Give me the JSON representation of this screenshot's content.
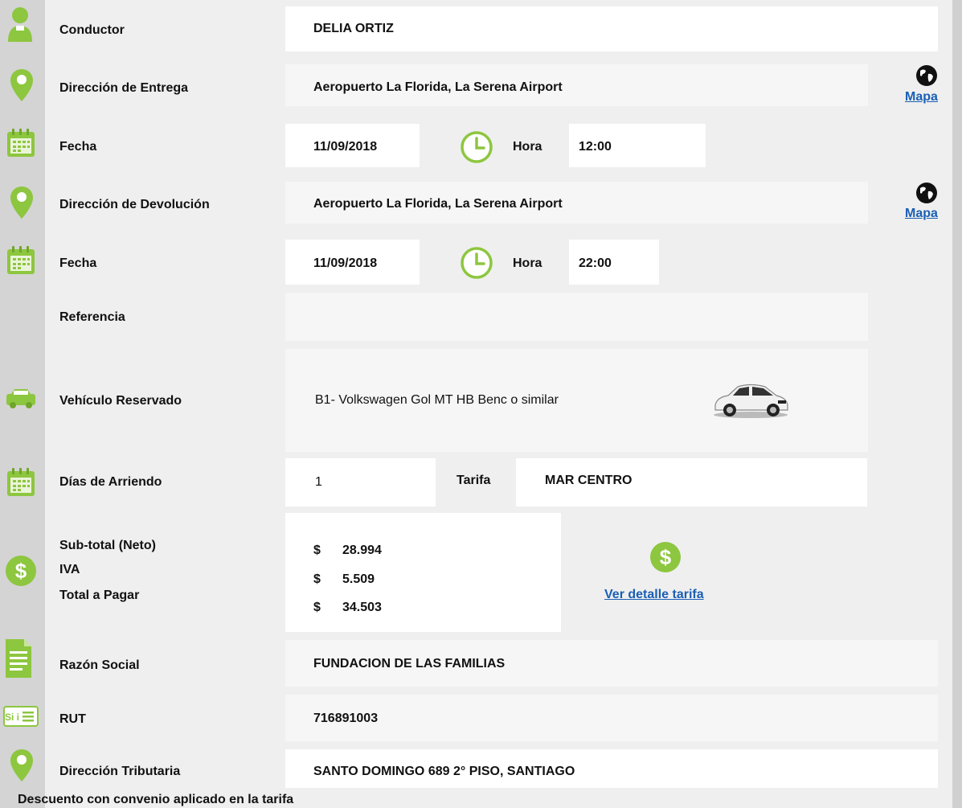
{
  "fields": {
    "conductor": {
      "label": "Conductor",
      "value": "DELIA ORTIZ"
    },
    "entrega": {
      "label": "Dirección de Entrega",
      "value": "Aeropuerto La Florida, La Serena Airport",
      "map_link": "Mapa"
    },
    "fecha_entrega": {
      "label": "Fecha",
      "date": "11/09/2018",
      "hora_label": "Hora",
      "hora": "12:00"
    },
    "devolucion": {
      "label": "Dirección de Devolución",
      "value": "Aeropuerto La Florida, La Serena Airport",
      "map_link": "Mapa"
    },
    "fecha_devolucion": {
      "label": "Fecha",
      "date": "11/09/2018",
      "hora_label": "Hora",
      "hora": "22:00"
    },
    "referencia": {
      "label": "Referencia",
      "value": ""
    },
    "vehiculo": {
      "label": "Vehículo Reservado",
      "value": "B1- Volkswagen Gol MT HB Benc o similar"
    },
    "dias": {
      "label": "Días de Arriendo",
      "value": "1",
      "tarifa_label": "Tarifa",
      "tarifa": "MAR CENTRO"
    },
    "totales": {
      "subtotal_label": "Sub-total (Neto)",
      "iva_label": "IVA",
      "total_label": "Total a Pagar",
      "currency": "$",
      "subtotal": "28.994",
      "iva": "5.509",
      "total": "34.503",
      "detail_link": "Ver detalle tarifa"
    },
    "razon_social": {
      "label": "Razón Social",
      "value": "FUNDACION DE LAS FAMILIAS"
    },
    "rut": {
      "label": "RUT",
      "value": "716891003",
      "icon_text": "Si i"
    },
    "direccion_tributaria": {
      "label": "Dirección Tributaria",
      "value": "SANTO DOMINGO 689 2° PISO, SANTIAGO"
    }
  },
  "footer": "Descuento con convenio  aplicado en la tarifa",
  "icons": {
    "person": "person-icon",
    "pin": "location-pin-icon",
    "calendar": "calendar-icon",
    "clock": "clock-icon",
    "globe": "globe-icon",
    "car": "car-icon",
    "dollar": "dollar-icon",
    "document": "document-icon",
    "id": "id-card-icon"
  },
  "colors": {
    "accent_green": "#8dc63f",
    "link_blue": "#1a5fb4"
  }
}
